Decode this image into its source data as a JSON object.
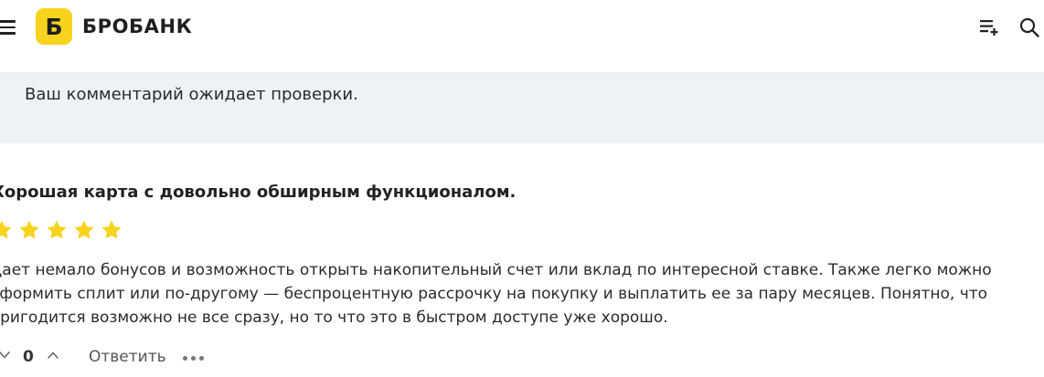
{
  "header": {
    "logo_letter": "Б",
    "logo_text": "БРОБАНК",
    "menu_icon": "hamburger-menu-icon",
    "list_icon": "playlist-add-icon",
    "search_icon": "search-icon"
  },
  "notice": {
    "text": "Ваш комментарий ожидает проверки."
  },
  "review": {
    "title": "Хорошая карта с довольно обширным функционалом.",
    "rating": 5,
    "rating_max": 5,
    "star_color": "#f7d31e",
    "body_lines": [
      "Дает немало бонусов и возможность открыть накопительный счет или вклад по интересной ставке. Также легко можно",
      "оформить сплит или по-другому — беспроцентную рассрочку на покупку и выплатить ее за пару месяцев. Понятно, что",
      "пригодится возможно не все сразу, но то что это в быстром доступе уже хорошо."
    ]
  },
  "actions": {
    "vote_count": "0",
    "reply_label": "Ответить"
  },
  "colors": {
    "brand": "#f7d31e",
    "notice_bg": "#eef2f6"
  }
}
